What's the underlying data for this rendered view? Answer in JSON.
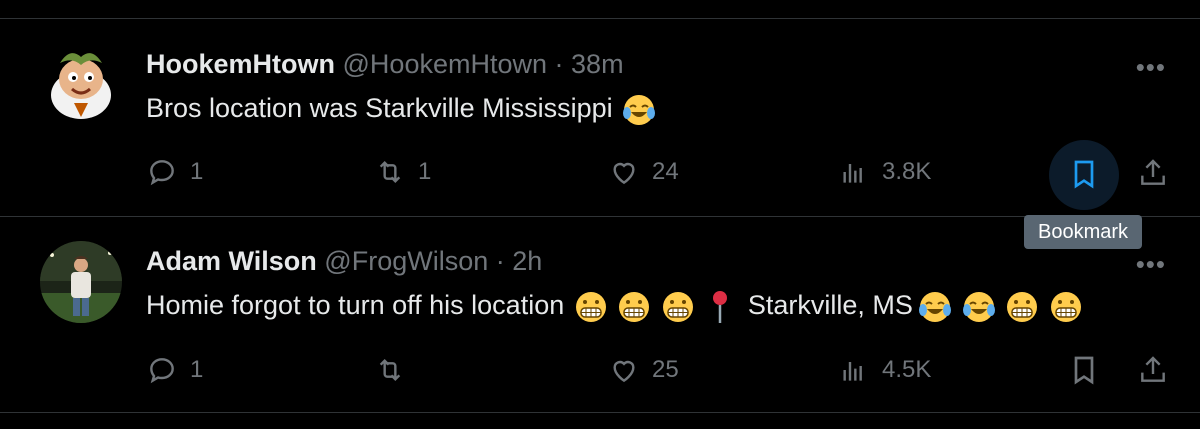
{
  "tweets": [
    {
      "name": "HookemHtown",
      "handle": "@HookemHtown",
      "separator": "·",
      "time": "38m",
      "text": "Bros location was Starkville Mississippi",
      "replies": "1",
      "retweets": "1",
      "likes": "24",
      "views": "3.8K",
      "bookmark_active": true
    },
    {
      "name": "Adam Wilson",
      "handle": "@FrogWilson",
      "separator": "·",
      "time": "2h",
      "text_before": "Homie forgot to turn off his location",
      "location": "Starkville, MS",
      "replies": "1",
      "retweets": "",
      "likes": "25",
      "views": "4.5K",
      "bookmark_active": false
    }
  ],
  "more_label": "•••",
  "tooltip": "Bookmark",
  "icons": {
    "reply": "reply-icon",
    "retweet": "retweet-icon",
    "like": "heart-icon",
    "views": "views-icon",
    "bookmark": "bookmark-icon",
    "share": "share-icon"
  },
  "colors": {
    "accent": "#1d9bf0",
    "muted": "#71767b",
    "text": "#e7e9ea",
    "background": "#000000"
  }
}
